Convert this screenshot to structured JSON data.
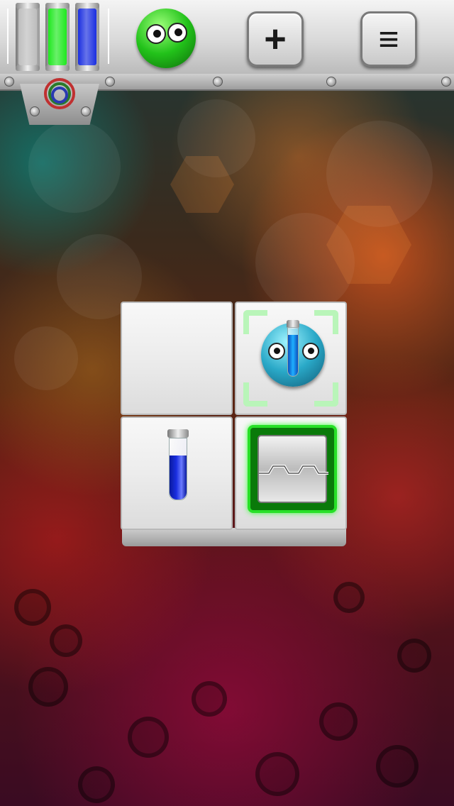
{
  "app": {
    "title": ""
  },
  "topbar": {
    "meters": [
      {
        "name": "gray",
        "color": "#bdbdbd",
        "level": 1.0
      },
      {
        "name": "green",
        "color": "#1fe81f",
        "level": 1.0
      },
      {
        "name": "blue",
        "color": "#1a2ee0",
        "level": 1.0
      }
    ],
    "current_blob": {
      "color": "#22c21a"
    },
    "add_button": {
      "label": "+",
      "icon": "plus-icon"
    },
    "menu_button": {
      "label": "≡",
      "icon": "menu-icon"
    }
  },
  "board": {
    "rows": 2,
    "cols": 2,
    "tiles": [
      {
        "row": 0,
        "col": 0,
        "content": "empty"
      },
      {
        "row": 0,
        "col": 1,
        "content": "blob",
        "color": "#2aa9c8",
        "holding": "blue-vial",
        "selected": true
      },
      {
        "row": 1,
        "col": 0,
        "content": "vial",
        "color": "#1a2ee0"
      },
      {
        "row": 1,
        "col": 1,
        "content": "exit-door",
        "highlight": "#27e027"
      }
    ]
  }
}
